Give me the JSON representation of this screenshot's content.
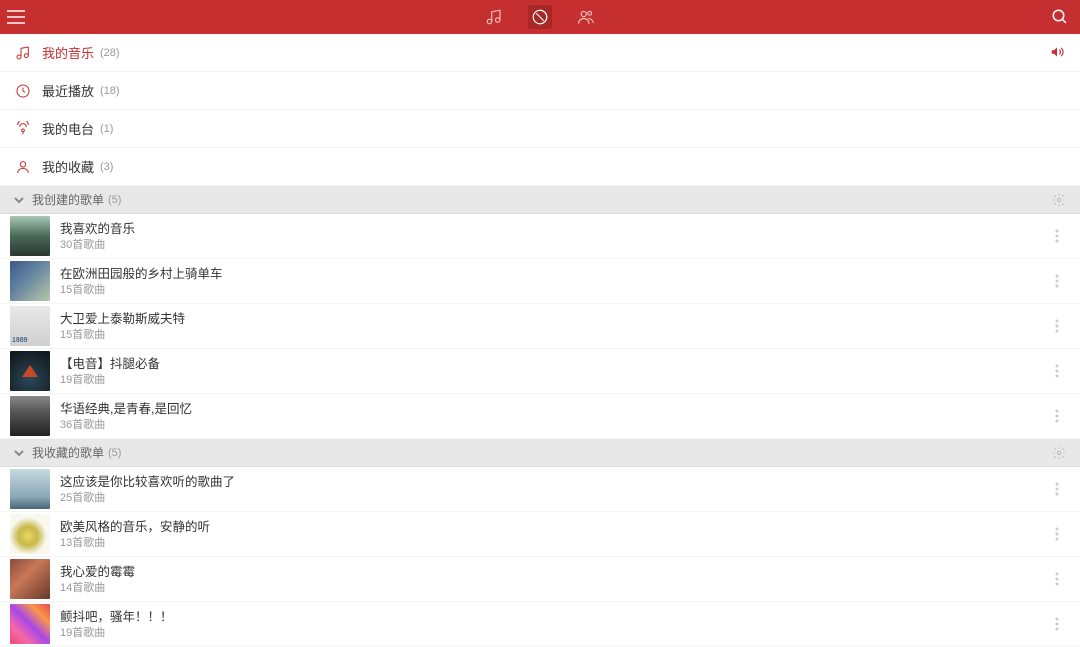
{
  "topbar": {
    "tabs": [
      "music",
      "discover",
      "friends"
    ],
    "active_tab": "discover"
  },
  "nav": [
    {
      "label": "我的音乐",
      "count": "(28)",
      "primary": true,
      "has_speaker": true
    },
    {
      "label": "最近播放",
      "count": "(18)",
      "primary": false
    },
    {
      "label": "我的电台",
      "count": "(1)",
      "primary": false
    },
    {
      "label": "我的收藏",
      "count": "(3)",
      "primary": false
    }
  ],
  "sections": {
    "created": {
      "title": "我创建的歌单",
      "count": "(5)",
      "items": [
        {
          "name": "我喜欢的音乐",
          "sub": "30首歌曲",
          "thumb": "th1"
        },
        {
          "name": "在欧洲田园般的乡村上骑单车",
          "sub": "15首歌曲",
          "thumb": "th2"
        },
        {
          "name": "大卫爱上泰勒斯威夫特",
          "sub": "15首歌曲",
          "thumb": "th3"
        },
        {
          "name": "【电音】抖腿必备",
          "sub": "19首歌曲",
          "thumb": "th4"
        },
        {
          "name": "华语经典,是青春,是回忆",
          "sub": "36首歌曲",
          "thumb": "th5"
        }
      ]
    },
    "fav": {
      "title": "我收藏的歌单",
      "count": "(5)",
      "items": [
        {
          "name": "这应该是你比较喜欢听的歌曲了",
          "sub": "25首歌曲",
          "thumb": "th6"
        },
        {
          "name": "欧美风格的音乐，安静的听",
          "sub": "13首歌曲",
          "thumb": "th7"
        },
        {
          "name": "我心爱的霉霉",
          "sub": "14首歌曲",
          "thumb": "th8"
        },
        {
          "name": "颤抖吧，骚年！！！",
          "sub": "19首歌曲",
          "thumb": "th9"
        }
      ]
    }
  }
}
